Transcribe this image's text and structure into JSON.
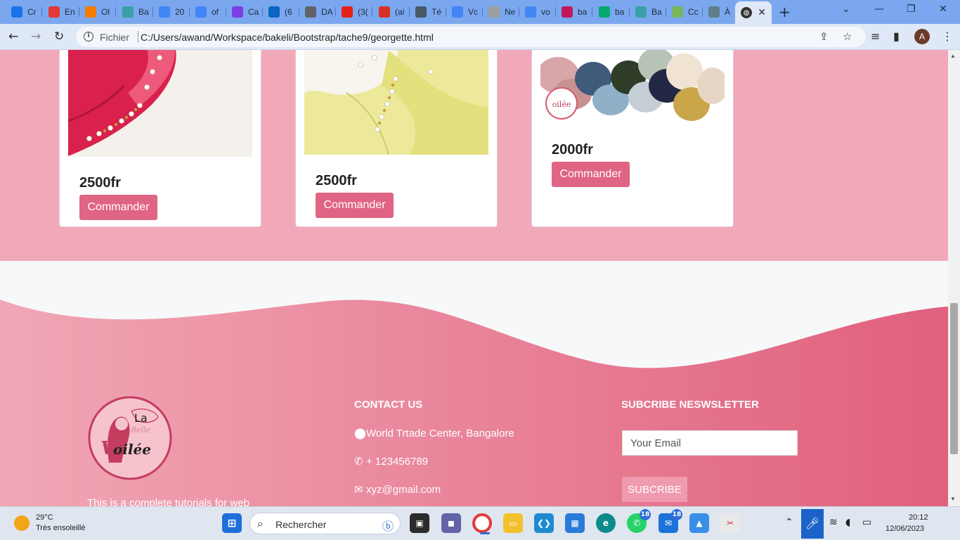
{
  "browser": {
    "tabs": [
      {
        "label": "Cr",
        "icon": "chrome-icon",
        "color": "#1a73e8"
      },
      {
        "label": "En",
        "icon": "letter-a-icon",
        "color": "#e53935"
      },
      {
        "label": "Ol",
        "icon": "cloud-icon",
        "color": "#f57c00"
      },
      {
        "label": "Ba",
        "icon": "pen-icon",
        "color": "#3aa0a8"
      },
      {
        "label": "20",
        "icon": "doc-icon",
        "color": "#4285f4"
      },
      {
        "label": "of",
        "icon": "google-icon",
        "color": "#4285f4"
      },
      {
        "label": "Ca",
        "icon": "letter-b-icon",
        "color": "#7b3fe4"
      },
      {
        "label": "(6",
        "icon": "linkedin-icon",
        "color": "#0a66c2"
      },
      {
        "label": "DA",
        "icon": "lock-doc-icon",
        "color": "#5f6368"
      },
      {
        "label": "(3(",
        "icon": "youtube-icon",
        "color": "#e62117"
      },
      {
        "label": "(ai",
        "icon": "gmail-icon",
        "color": "#d93025"
      },
      {
        "label": "Té",
        "icon": "grad-cap-icon",
        "color": "#455a64"
      },
      {
        "label": "Vc",
        "icon": "google-icon",
        "color": "#4285f4"
      },
      {
        "label": "Ne",
        "icon": "notion-icon",
        "color": "#9e9e9e"
      },
      {
        "label": "vo",
        "icon": "google-icon",
        "color": "#4285f4"
      },
      {
        "label": "ba",
        "icon": "tag-icon",
        "color": "#c2185b"
      },
      {
        "label": "ba",
        "icon": "w3schools-icon",
        "color": "#04aa6d"
      },
      {
        "label": "Ba",
        "icon": "pen-icon",
        "color": "#3aa0a8"
      },
      {
        "label": "Cc",
        "icon": "shopify-icon",
        "color": "#7ab55c"
      },
      {
        "label": "À",
        "icon": "school-icon",
        "color": "#607d8b"
      }
    ],
    "active_tab_icon": "globe-icon",
    "url_scheme": "Fichier",
    "url": "C:/Users/awand/Workspace/bakeli/Bootstrap/tache9/georgette.html",
    "profile_initial": "A"
  },
  "products": [
    {
      "price": "2500fr",
      "button": "Commander",
      "image": "pink-pearl-fabric"
    },
    {
      "price": "2500fr",
      "button": "Commander",
      "image": "yellow-pearl-fabric"
    },
    {
      "price": "2000fr",
      "button": "Commander",
      "image": "folded-veils"
    }
  ],
  "footer": {
    "logo": {
      "line1": "La",
      "line2": "Belle",
      "line3": "oilée",
      "initial": "V"
    },
    "contact_title": "CONTACT US",
    "address": "World Trtade Center, Bangalore",
    "phone": "+ 123456789",
    "email": "xyz@gmail.com",
    "newsletter_title": "SUBCRIBE NESWSLETTER",
    "email_placeholder": "Your Email",
    "subscribe_button": "SUBCRIBE",
    "about_text": "This is a complete tutorials for web"
  },
  "colors": {
    "section_bg": "#f1a9b9",
    "button": "#e06483",
    "footer_gradient_start": "#f1a7b5",
    "footer_gradient_end": "#e0607d"
  },
  "taskbar": {
    "temperature": "29°C",
    "weather": "Très ensoleillé",
    "search_placeholder": "Rechercher",
    "whatsapp_badge": "18",
    "mail_badge": "18",
    "time": "20:12",
    "date": "12/06/2023"
  }
}
